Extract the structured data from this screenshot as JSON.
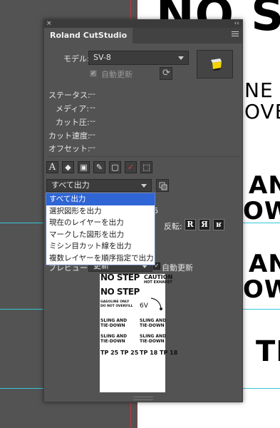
{
  "background_canvas": {
    "texts": [
      "NO S",
      "NE C",
      "OVE",
      "AN",
      "OW",
      "AN",
      "OW",
      "TR"
    ]
  },
  "panel": {
    "close_glyph": "×",
    "collapse_glyph": "‹‹",
    "tab_label": "Roland CutStudio",
    "model_label": "モデル:",
    "model_value": "SV-8",
    "auto_update_top_label": "自動更新",
    "auto_update_top_check": "✓",
    "refresh_glyph": "⟳",
    "status": [
      {
        "label": "ステータス:",
        "value": "--"
      },
      {
        "label": "メディア:",
        "value": "--"
      },
      {
        "label": "カット圧:",
        "value": "--"
      },
      {
        "label": "カット速度:",
        "value": "--"
      },
      {
        "label": "オフセット:",
        "value": "--"
      }
    ],
    "tool_icons": [
      {
        "name": "text-outline-icon",
        "glyph": "A"
      },
      {
        "name": "eraser-icon",
        "glyph": "◆"
      },
      {
        "name": "group-shapes-icon",
        "glyph": "▣"
      },
      {
        "name": "pen-path-icon",
        "glyph": "✎"
      },
      {
        "name": "crop-marks-icon",
        "glyph": "▢"
      },
      {
        "name": "checkmark-icon",
        "glyph": "✓"
      },
      {
        "name": "selection-box-icon",
        "glyph": "⬚"
      }
    ],
    "output_select_value": "すべて出力",
    "dropdown_options": [
      "すべて出力",
      "選択図形を出力",
      "現在のレイヤーを出力",
      "マークした図形を出力",
      "ミシン目カット線を出力",
      "複数レイヤーを順序指定で出力"
    ],
    "dropdown_active_index": 0,
    "partial_digit": "6",
    "reverse_label": "反転:",
    "reverse_buttons": [
      "R",
      "Я",
      "ʁ"
    ],
    "preview_label": "プレビュー:",
    "preview_select_value": "更新",
    "auto_update_bottom_label": "自動更新",
    "auto_update_bottom_check": "✓",
    "preview_texts": {
      "no_step_1": "NO STEP",
      "caution": "CAUTION",
      "not_exhaust": "HOT EXHAUST",
      "no_step_2": "NO STEP",
      "gasoline": "GASOLINE ONLY",
      "do_not_overfill": "DO NOT OVERFILL",
      "sixv": "6V",
      "sling_1": "SLING AND",
      "tiedown_1": "TIE-DOWN",
      "sling_2": "SLING AND",
      "tiedown_2": "TIE-DOWN",
      "sling_3": "SLING AND",
      "tiedown_3": "TIE-DOWN",
      "sling_4": "SLING AND",
      "tiedown_4": "TIE-DOWN",
      "tp25": "TP 25 TP 25",
      "tp18": "TP 18 TP 18"
    }
  },
  "colors": {
    "panel_bg": "#535353",
    "dropdown_highlight": "#2f65d4",
    "guide_red": "#c2383d",
    "guide_cyan": "#34c7d9"
  }
}
